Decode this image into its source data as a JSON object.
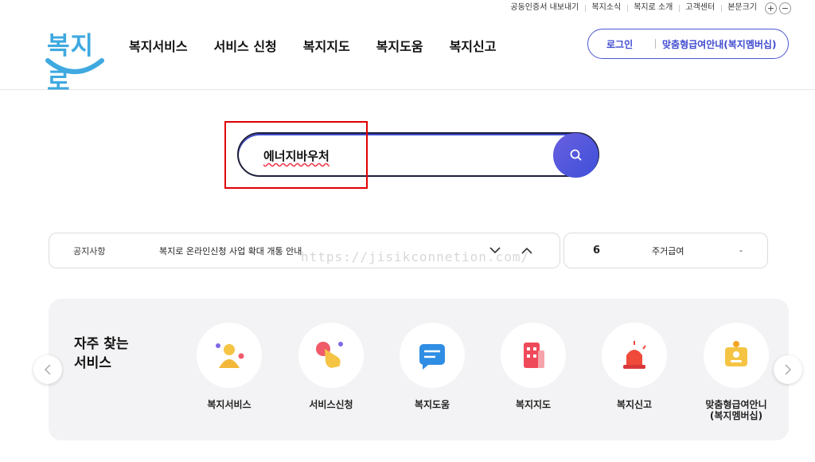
{
  "utility": {
    "items": [
      "공동인증서 내보내기",
      "복지소식",
      "복지로 소개",
      "고객센터",
      "본문크기"
    ],
    "zoom_in": "+",
    "zoom_out": "−"
  },
  "header": {
    "logo_text": "복지로",
    "nav": [
      "복지서비스",
      "서비스 신청",
      "복지지도",
      "복지도움",
      "복지신고"
    ],
    "login": "로그인",
    "membership": "맞춤형급여안내(복지멤버십)"
  },
  "search": {
    "value": "에너지바우처",
    "icon": "search-icon"
  },
  "notice": {
    "tag": "공지사항",
    "message": "복지로 온라인신청 사업 확대 개통 안내"
  },
  "ranking": {
    "rank": "6",
    "label": "주거급여",
    "change": "-"
  },
  "watermark": "https://jisikconnetion.com/",
  "frequent": {
    "title": "자주 찾는\n서비스",
    "items": [
      {
        "label": "복지서비스",
        "icon": "person-icon"
      },
      {
        "label": "서비스신청",
        "icon": "hand-click-icon"
      },
      {
        "label": "복지도움",
        "icon": "chat-bubble-icon"
      },
      {
        "label": "복지지도",
        "icon": "building-icon"
      },
      {
        "label": "복지신고",
        "icon": "siren-icon"
      },
      {
        "label": "맞춤형급여안니\n(복지멤버십)",
        "icon": "id-card-icon"
      }
    ]
  },
  "colors": {
    "accent": "#3f4ad0",
    "logo": "#3fa9e0",
    "highlight": "#e00000",
    "panel": "#f3f3f5"
  }
}
